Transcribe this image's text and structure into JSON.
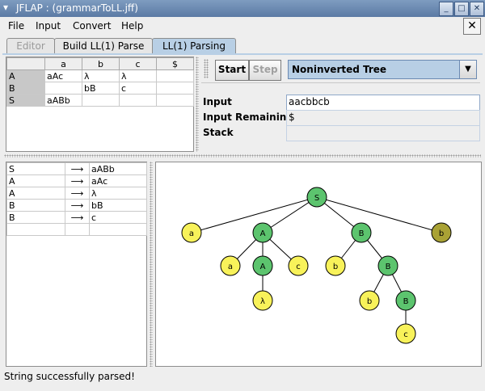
{
  "window": {
    "title": "JFLAP : (grammarToLL.jff)"
  },
  "menubar": {
    "items": [
      "File",
      "Input",
      "Convert",
      "Help"
    ],
    "close_glyph": "✕"
  },
  "tabs": [
    {
      "label": "Editor",
      "state": "disabled"
    },
    {
      "label": "Build LL(1) Parse",
      "state": "normal"
    },
    {
      "label": "LL(1) Parsing",
      "state": "active"
    }
  ],
  "parse_table": {
    "columns": [
      "",
      "a",
      "b",
      "c",
      "$"
    ],
    "rows": [
      [
        "A",
        "aAc",
        "λ",
        "λ",
        ""
      ],
      [
        "B",
        "",
        "bB",
        "c",
        ""
      ],
      [
        "S",
        "aABb",
        "",
        "",
        ""
      ]
    ]
  },
  "controls": {
    "start_label": "Start",
    "step_label": "Step",
    "view_select": "Noninverted Tree",
    "input_label": "Input",
    "input_value": "aacbbcb",
    "remaining_label": "Input Remaining",
    "remaining_value": "$",
    "stack_label": "Stack",
    "stack_value": ""
  },
  "productions": [
    {
      "lhs": "S",
      "arrow": "⟶",
      "rhs": "aABb"
    },
    {
      "lhs": "A",
      "arrow": "⟶",
      "rhs": "aAc"
    },
    {
      "lhs": "A",
      "arrow": "⟶",
      "rhs": "λ"
    },
    {
      "lhs": "B",
      "arrow": "⟶",
      "rhs": "bB"
    },
    {
      "lhs": "B",
      "arrow": "⟶",
      "rhs": "c"
    },
    {
      "lhs": "",
      "arrow": "",
      "rhs": ""
    }
  ],
  "colors": {
    "nonterminal": "#5cc46e",
    "terminal": "#f8f25a",
    "highlighted": "#a9a235",
    "title_bar": "#6a88b2",
    "active_tab": "#b8cfe5"
  },
  "tree": {
    "nodes": [
      {
        "id": "n0",
        "label": "S",
        "kind": "nonterminal",
        "parent": null
      },
      {
        "id": "n1",
        "label": "a",
        "kind": "terminal",
        "parent": "n0"
      },
      {
        "id": "n2",
        "label": "A",
        "kind": "nonterminal",
        "parent": "n0"
      },
      {
        "id": "n3",
        "label": "B",
        "kind": "nonterminal",
        "parent": "n0"
      },
      {
        "id": "n4",
        "label": "b",
        "kind": "highlighted",
        "parent": "n0"
      },
      {
        "id": "n5",
        "label": "a",
        "kind": "terminal",
        "parent": "n2"
      },
      {
        "id": "n6",
        "label": "A",
        "kind": "nonterminal",
        "parent": "n2"
      },
      {
        "id": "n7",
        "label": "c",
        "kind": "terminal",
        "parent": "n2"
      },
      {
        "id": "n8",
        "label": "b",
        "kind": "terminal",
        "parent": "n3"
      },
      {
        "id": "n9",
        "label": "B",
        "kind": "nonterminal",
        "parent": "n3"
      },
      {
        "id": "n10",
        "label": "λ",
        "kind": "terminal",
        "parent": "n6"
      },
      {
        "id": "n11",
        "label": "b",
        "kind": "terminal",
        "parent": "n9"
      },
      {
        "id": "n12",
        "label": "B",
        "kind": "nonterminal",
        "parent": "n9"
      },
      {
        "id": "n13",
        "label": "c",
        "kind": "terminal",
        "parent": "n12"
      }
    ]
  },
  "status": {
    "text": "String successfully parsed!"
  }
}
